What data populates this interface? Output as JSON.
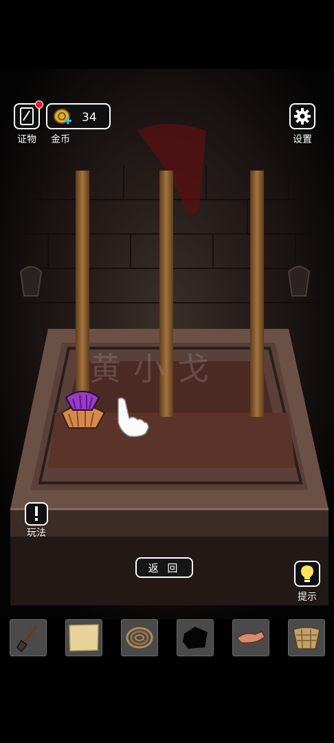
{
  "hud": {
    "evidence_label": "证物",
    "coins_label": "金币",
    "coins_value": "34",
    "settings_label": "设置",
    "rules_label": "玩法",
    "hint_label": "提示",
    "evidence_has_notification": true
  },
  "back_button_label": "返 回",
  "watermark": "黄小戈",
  "inventory": [
    {
      "icon": "shovel-icon"
    },
    {
      "icon": "paper-map-icon"
    },
    {
      "icon": "coiled-rope-icon"
    },
    {
      "icon": "black-stone-icon"
    },
    {
      "icon": "dried-fish-icon"
    },
    {
      "icon": "basket-icon"
    }
  ],
  "puzzle": {
    "pegs": 3,
    "disks_on_peg_1": [
      "purple-shell",
      "orange-shell"
    ]
  },
  "colors": {
    "notification": "#e32222",
    "hint_bulb": "#ffe45a",
    "coin": "#e0b030"
  }
}
